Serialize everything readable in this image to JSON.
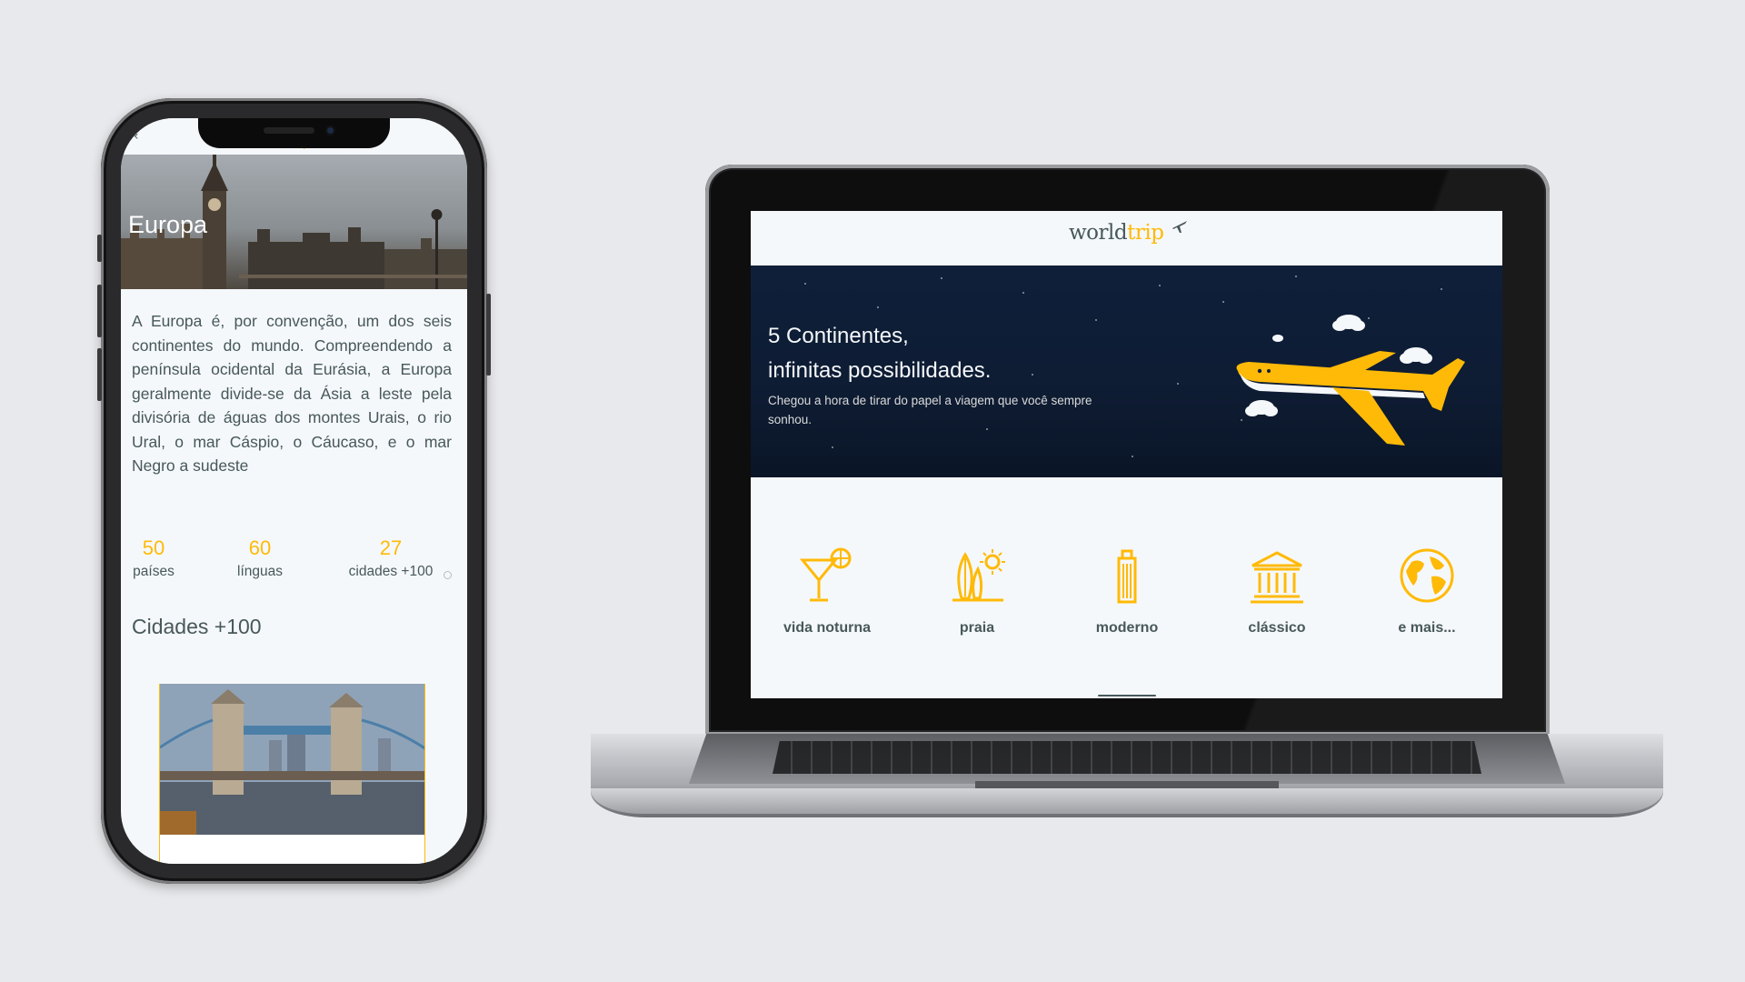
{
  "mobile": {
    "back_icon": "chevron-left",
    "logo": {
      "world": "world",
      "trip": "trip"
    },
    "banner_title": "Europa",
    "description": "A Europa é, por convenção, um dos seis continentes do mundo. Compreendendo a península ocidental da Eurásia, a Europa geralmente divide-se da Ásia a leste pela divisória de águas dos montes Urais, o rio Ural, o mar Cáspio, o Cáucaso, e o mar Negro a sudeste",
    "stats": [
      {
        "value": "50",
        "label": "países"
      },
      {
        "value": "60",
        "label": "línguas"
      },
      {
        "value": "27",
        "label": "cidades +100"
      }
    ],
    "cities_title": "Cidades +100"
  },
  "desktop": {
    "logo": {
      "world": "world",
      "trip": "trip"
    },
    "hero": {
      "title_line1": "5 Continentes,",
      "title_line2": "infinitas possibilidades.",
      "subtitle": "Chegou a hora de tirar do papel a viagem que você sempre sonhou."
    },
    "travel_types": [
      {
        "icon": "cocktail-icon",
        "label": "vida noturna"
      },
      {
        "icon": "surfboard-icon",
        "label": "praia"
      },
      {
        "icon": "building-icon",
        "label": "moderno"
      },
      {
        "icon": "museum-icon",
        "label": "clássico"
      },
      {
        "icon": "globe-icon",
        "label": "e mais..."
      }
    ]
  },
  "colors": {
    "accent": "#FFBA08",
    "text_dark": "#47585B",
    "light_bg": "#F5F8FA",
    "hero_bg": "#0F1F3A",
    "page_bg": "#E8E9EC"
  }
}
